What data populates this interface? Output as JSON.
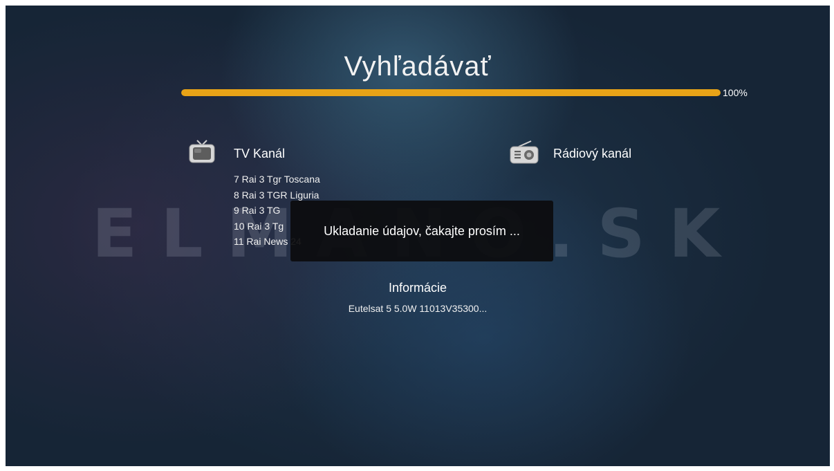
{
  "screen": {
    "title": "Vyhľadávať"
  },
  "progress": {
    "value_percent": 100,
    "label": "100%",
    "color": "#e8a317"
  },
  "watermark": {
    "text": "ELMANO.SK"
  },
  "tv": {
    "icon": "tv-icon",
    "heading": "TV Kanál",
    "channels": [
      "7 Rai 3 Tgr Toscana",
      "8 Rai 3 TGR Liguria",
      "9 Rai 3 TG",
      "10 Rai 3 Tg",
      "11 Rai News 24"
    ]
  },
  "radio": {
    "icon": "radio-icon",
    "heading": "Rádiový kanál"
  },
  "info": {
    "label": "Informácie",
    "value": "Eutelsat 5 5.0W 11013V35300..."
  },
  "dialog": {
    "message": "Ukladanie údajov, čakajte prosím ..."
  }
}
